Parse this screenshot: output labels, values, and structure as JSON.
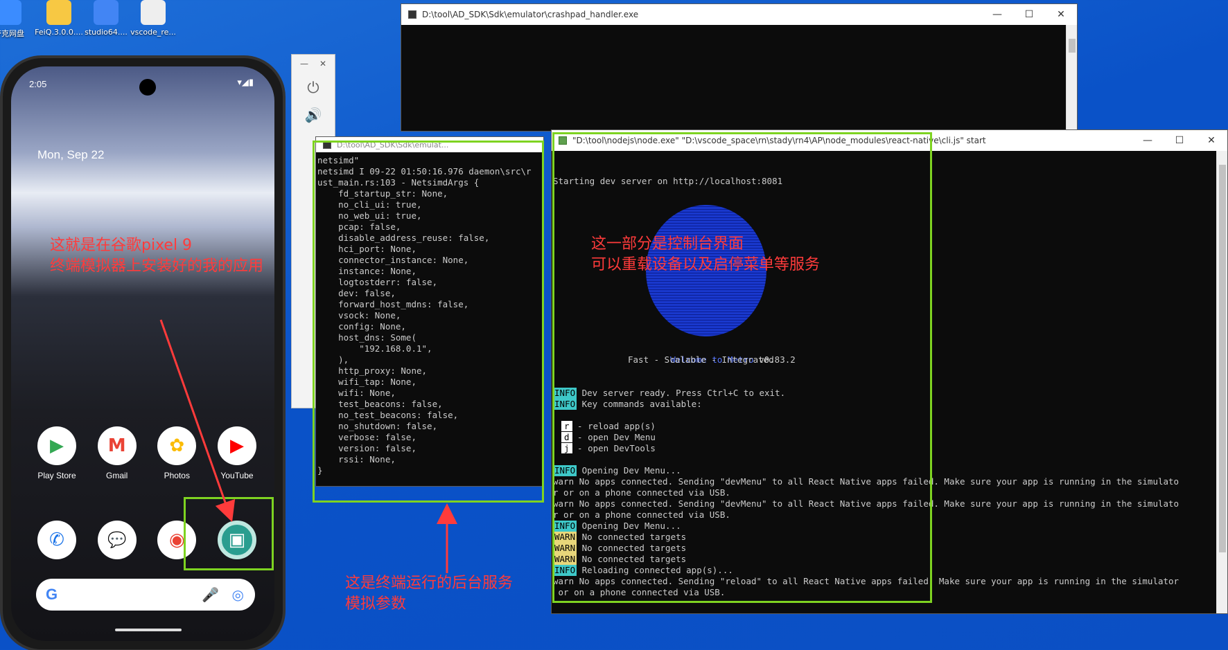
{
  "desktop": {
    "icons": [
      {
        "label": "夸克网盘"
      },
      {
        "label": "FeiQ.3.0.0...."
      },
      {
        "label": "studio64...."
      },
      {
        "label": "vscode_re..."
      }
    ]
  },
  "win_crashpad": {
    "title": "D:\\tool\\AD_SDK\\Sdk\\emulator\\crashpad_handler.exe",
    "min": "—",
    "max": "☐",
    "close": "✕"
  },
  "win_netsim": {
    "title": "D:\\tool\\AD_SDK\\Sdk\\emulat...",
    "lines": [
      "netsimd\"",
      "netsimd I 09-22 01:50:16.976 daemon\\src\\r",
      "ust_main.rs:103 - NetsimdArgs {",
      "    fd_startup_str: None,",
      "    no_cli_ui: true,",
      "    no_web_ui: true,",
      "    pcap: false,",
      "    disable_address_reuse: false,",
      "    hci_port: None,",
      "    connector_instance: None,",
      "    instance: None,",
      "    logtostderr: false,",
      "    dev: false,",
      "    forward_host_mdns: false,",
      "    vsock: None,",
      "    config: None,",
      "    host_dns: Some(",
      "        \"192.168.0.1\",",
      "    ),",
      "    http_proxy: None,",
      "    wifi_tap: None,",
      "    wifi: None,",
      "    test_beacons: false,",
      "    no_test_beacons: false,",
      "    no_shutdown: false,",
      "    verbose: false,",
      "    version: false,",
      "    rssi: None,",
      "}"
    ]
  },
  "win_metro": {
    "title": "\"D:\\tool\\nodejs\\node.exe\"    \"D:\\vscode_space\\rn\\stady\\rn4\\AP\\node_modules\\react-native\\cli.js\" start",
    "starting": "Starting dev server on http://localhost:8081",
    "welcome": "Welcome to Metro",
    "version": " v0.83.2",
    "tagline": "Fast - Scalable - Integrated",
    "log": [
      {
        "tag": "INFO",
        "text": " Dev server ready. Press Ctrl+C to exit."
      },
      {
        "tag": "INFO",
        "text": " Key commands available:"
      }
    ],
    "keys": [
      {
        "key": "r",
        "desc": " - reload app(s)"
      },
      {
        "key": "d",
        "desc": " - open Dev Menu"
      },
      {
        "key": "j",
        "desc": " - open DevTools"
      }
    ],
    "log2": [
      {
        "tag": "INFO",
        "text": " Opening Dev Menu..."
      },
      {
        "tag": "",
        "text": "warn No apps connected. Sending \"devMenu\" to all React Native apps failed. Make sure your app is running in the simulato"
      },
      {
        "tag": "",
        "text": "r or on a phone connected via USB."
      },
      {
        "tag": "",
        "text": "warn No apps connected. Sending \"devMenu\" to all React Native apps failed. Make sure your app is running in the simulato"
      },
      {
        "tag": "",
        "text": "r or on a phone connected via USB."
      },
      {
        "tag": "INFO",
        "text": " Opening Dev Menu..."
      },
      {
        "tag": "WARN",
        "text": " No connected targets"
      },
      {
        "tag": "WARN",
        "text": " No connected targets"
      },
      {
        "tag": "WARN",
        "text": " No connected targets"
      },
      {
        "tag": "INFO",
        "text": " Reloading connected app(s)..."
      },
      {
        "tag": "",
        "text": "warn No apps connected. Sending \"reload\" to all React Native apps failed. Make sure your app is running in the simulator"
      },
      {
        "tag": "",
        "text": " or on a phone connected via USB."
      }
    ]
  },
  "phone": {
    "time": "2:05",
    "date": "Mon, Sep 22",
    "apps_row1": [
      {
        "label": "Play Store",
        "glyph": "▶",
        "color": "#34a853"
      },
      {
        "label": "Gmail",
        "glyph": "M",
        "color": "#ea4335"
      },
      {
        "label": "Photos",
        "glyph": "✿",
        "color": "#fbbc05"
      },
      {
        "label": "YouTube",
        "glyph": "▶",
        "color": "#ff0000"
      }
    ],
    "apps_row2": [
      {
        "glyph": "✆",
        "color": "#1a73e8"
      },
      {
        "glyph": "💬",
        "color": "#1a73e8"
      },
      {
        "glyph": "◉",
        "color": "#ea4335"
      },
      {
        "glyph": "▣",
        "color": "#2a9d8f"
      }
    ],
    "search_g": "G"
  },
  "annotations": {
    "phone_note_1": "这就是在谷歌pixel 9",
    "phone_note_2": "终端模拟器上安装好的我的应用",
    "console_note_1": "这一部分是控制台界面",
    "console_note_2": "可以重载设备以及启停菜单等服务",
    "service_note_1": "这是终端运行的后台服务",
    "service_note_2": "模拟参数"
  },
  "colors": {
    "annotation": "#ff3b3b",
    "highlight": "#7ed321",
    "info": "#3ec8c8",
    "warn": "#e8d67a"
  }
}
